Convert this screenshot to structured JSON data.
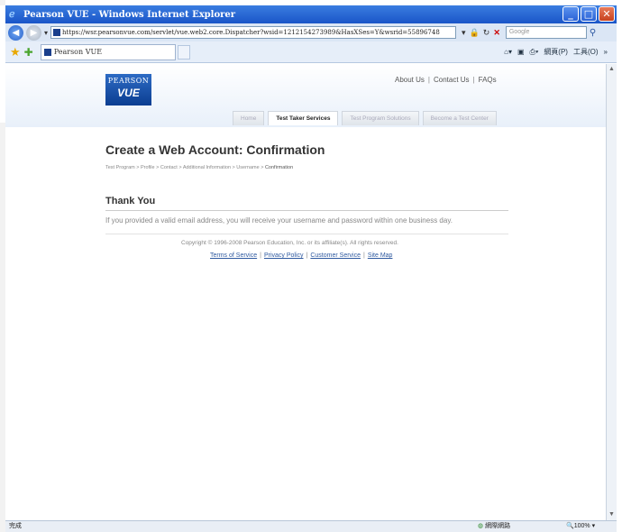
{
  "window": {
    "title": "Pearson VUE - Windows Internet Explorer",
    "minimize": "_",
    "maximize": "□",
    "close": "✕"
  },
  "browser": {
    "url": "https://wsr.pearsonvue.com/servlet/vue.web2.core.Dispatcher?wsid=1212154273989&HasXSes=Y&wsrid=55896748",
    "search_placeholder": "Google",
    "tab_label": "Pearson VUE",
    "page_menu": "網頁(P)",
    "tools_menu": "工具(O)"
  },
  "header": {
    "logo_top": "PEARSON",
    "logo_bottom": "VUE",
    "links": [
      "About Us",
      "Contact Us",
      "FAQs"
    ],
    "tabs": [
      {
        "label": "Home",
        "active": false
      },
      {
        "label": "Test Taker Services",
        "active": true
      },
      {
        "label": "Test Program Solutions",
        "active": false
      },
      {
        "label": "Become a Test Center",
        "active": false
      }
    ]
  },
  "main": {
    "title": "Create a Web Account: Confirmation",
    "breadcrumb": [
      "Test Program",
      "Profile",
      "Contact",
      "Additional Information",
      "Username",
      "Confirmation"
    ],
    "section_title": "Thank You",
    "message": "If you provided a valid email address, you will receive your username and password within one business day."
  },
  "footer": {
    "copyright": "Copyright © 1996-2008 Pearson Education, Inc. or its affiliate(s). All rights reserved.",
    "links": [
      "Terms of Service",
      "Privacy Policy",
      "Customer Service",
      "Site Map"
    ]
  },
  "status": {
    "left": "完成",
    "zone": "網際網路",
    "zoom": "100%"
  }
}
